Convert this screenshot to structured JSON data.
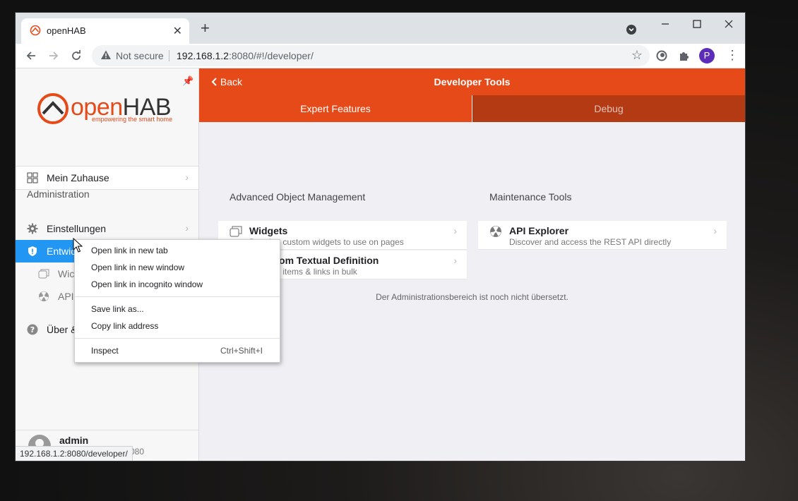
{
  "browser": {
    "tab_title": "openHAB",
    "tab_close": "✕",
    "new_tab": "+",
    "not_secure": "Not secure",
    "url_host": "192.168.1.2",
    "url_rest": ":8080/#!/developer/",
    "profile_initial": "P",
    "status_url": "192.168.1.2:8080/developer/"
  },
  "sidebar": {
    "logo_open": "open",
    "logo_hab": "HAB",
    "logo_tagline": "empowering the smart home",
    "home_item": "Mein Zuhause",
    "section_title": "Administration",
    "settings_item": "Einstellungen",
    "dev_tools_item": "Entwickler Tools",
    "sub_widgets": "Wic",
    "sub_api": "API",
    "about_item": "Über &",
    "user_name": "admin",
    "user_host": "080"
  },
  "main": {
    "back": "Back",
    "title": "Developer Tools",
    "tab_expert": "Expert Features",
    "tab_debug": "Debug",
    "aom_title": "Advanced Object Management",
    "maint_title": "Maintenance Tools",
    "widgets_title": "Widgets",
    "widgets_desc": "Develop custom widgets to use on pages",
    "items_title": "ems from Textual Definition",
    "items_desc": "r update items & links in bulk",
    "api_title": "API Explorer",
    "api_desc": "Discover and access the REST API directly",
    "note": "Der Administrationsbereich ist noch nicht übersetzt."
  },
  "context_menu": {
    "open_new_tab": "Open link in new tab",
    "open_new_window": "Open link in new window",
    "open_incognito": "Open link in incognito window",
    "save_link": "Save link as...",
    "copy_link": "Copy link address",
    "inspect": "Inspect",
    "inspect_shortcut": "Ctrl+Shift+I"
  },
  "colors": {
    "brand": "#e64a19",
    "active": "#2196f3"
  }
}
